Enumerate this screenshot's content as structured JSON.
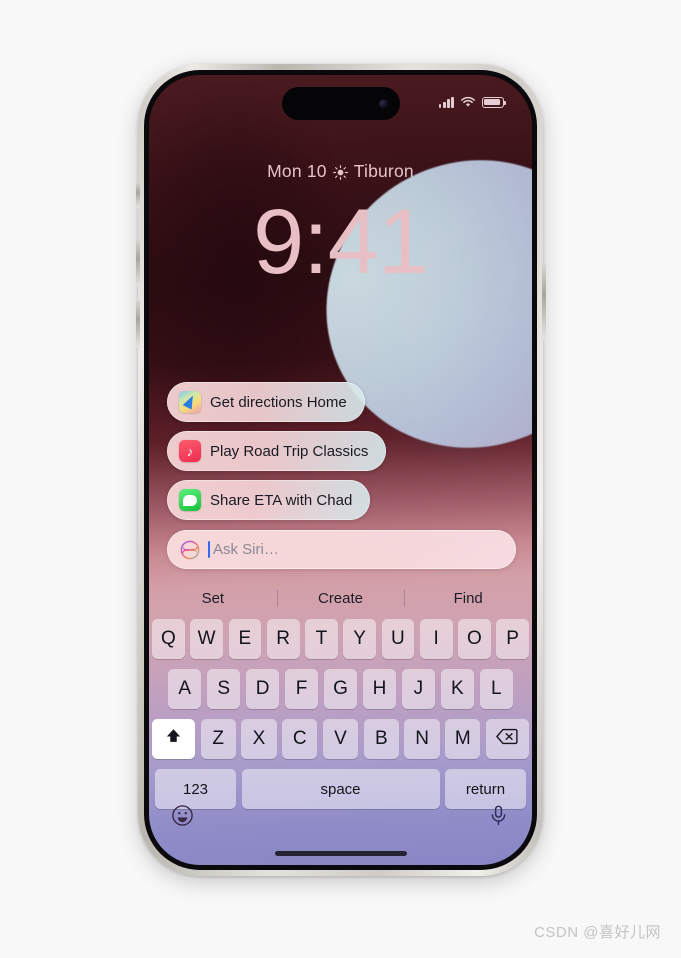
{
  "page": {
    "background_color": "#f8f8f8",
    "watermark": "CSDN @喜好儿网"
  },
  "device": {
    "name": "iPhone",
    "frame_color": "#d5d2cd",
    "buttons": [
      "action-button",
      "volume-up",
      "volume-down",
      "power-button"
    ]
  },
  "status_bar": {
    "cellular_icon": "cellular-bars-icon",
    "wifi_icon": "wifi-icon",
    "battery_icon": "battery-icon",
    "battery_level_percent": 92,
    "icon_color": "#e7cdd3"
  },
  "lock_screen": {
    "date": "Mon 10",
    "weather_icon": "sun-icon",
    "location": "Tiburon",
    "time": "9:41",
    "time_color": "#e8bfc4",
    "date_color": "#e6c3c7"
  },
  "siri": {
    "suggestions": [
      {
        "icon": "maps-icon",
        "label": "Get directions Home"
      },
      {
        "icon": "music-icon",
        "label": "Play Road Trip Classics"
      },
      {
        "icon": "messages-icon",
        "label": "Share ETA with Chad"
      }
    ],
    "input": {
      "icon": "siri-icon",
      "placeholder": "Ask Siri…",
      "value": "",
      "caret_color": "#2f6df0",
      "placeholder_color": "#8a8794"
    }
  },
  "keyboard": {
    "predictive": [
      "Set",
      "Create",
      "Find"
    ],
    "row1": [
      "Q",
      "W",
      "E",
      "R",
      "T",
      "Y",
      "U",
      "I",
      "O",
      "P"
    ],
    "row2": [
      "A",
      "S",
      "D",
      "F",
      "G",
      "H",
      "J",
      "K",
      "L"
    ],
    "row3_letters": [
      "Z",
      "X",
      "C",
      "V",
      "B",
      "N",
      "M"
    ],
    "shift_key": {
      "icon": "shift-icon",
      "active": true
    },
    "backspace_key": {
      "icon": "backspace-icon"
    },
    "numbers_key": "123",
    "space_key": "space",
    "return_key": "return",
    "emoji_key_icon": "emoji-icon",
    "dictation_key_icon": "microphone-icon",
    "home_indicator": "home-indicator"
  }
}
